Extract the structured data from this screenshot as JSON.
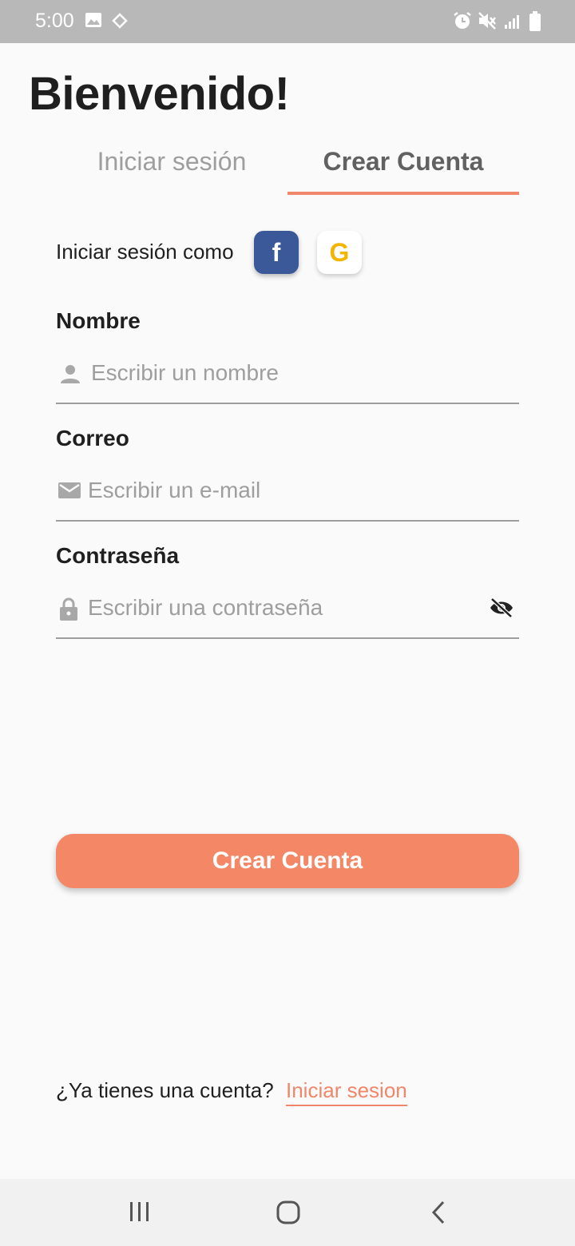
{
  "status_bar": {
    "time": "5:00",
    "icons": [
      "image-icon",
      "navigation-icon",
      "alarm-icon",
      "mute-icon",
      "signal-icon",
      "battery-icon"
    ]
  },
  "header": {
    "title": "Bienvenido!"
  },
  "tabs": [
    {
      "label": "Iniciar sesión",
      "active": false
    },
    {
      "label": "Crear Cuenta",
      "active": true
    }
  ],
  "social": {
    "label": "Iniciar sesión como",
    "facebook_glyph": "f",
    "google_glyph": "G"
  },
  "form": {
    "name": {
      "label": "Nombre",
      "placeholder": "Escribir un nombre",
      "value": ""
    },
    "email": {
      "label": "Correo",
      "placeholder": "Escribir un e-mail",
      "value": ""
    },
    "password": {
      "label": "Contraseña",
      "placeholder": "Escribir una contraseña",
      "value": ""
    }
  },
  "submit": {
    "label": "Crear Cuenta"
  },
  "footer": {
    "text": "¿Ya tienes una cuenta?",
    "link": "Iniciar sesion"
  },
  "colors": {
    "accent": "#f48766",
    "facebook": "#3b5998",
    "google": "#f4b400",
    "status_bar": "#b8b8b8"
  }
}
